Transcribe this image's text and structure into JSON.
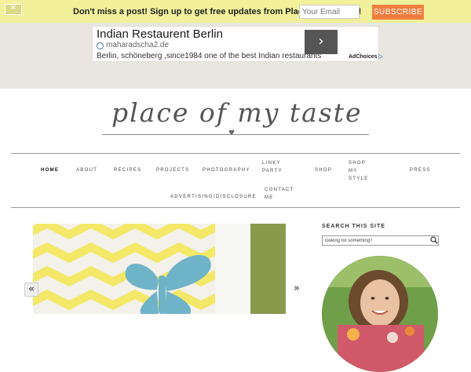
{
  "notify_bar": {
    "close_label": "✕",
    "message": "Don't miss a post! Sign up to get free updates from Place Of My Taste!",
    "email_placeholder": "Your Email",
    "subscribe_label": "SUBSCRIBE"
  },
  "ad": {
    "title": "Indian Restaurent Berlin",
    "url": "maharadscha2.de",
    "description": "Berlin, schöneberg ,since1984 one of the best Indian restaurants",
    "arrow": "›",
    "adchoices": "AdChoices"
  },
  "logo": {
    "text": "place of my taste",
    "heart": "♥"
  },
  "nav": {
    "items": [
      {
        "label": "HOME"
      },
      {
        "label": "ABOUT"
      },
      {
        "label": "RECIPES"
      },
      {
        "label": "PROJECTS"
      },
      {
        "label": "PHOTOGRAPHY"
      },
      {
        "label": "LINKY PARTY"
      },
      {
        "label": "SHOP"
      },
      {
        "label": "SHOP MY STYLE"
      },
      {
        "label": "PRESS"
      },
      {
        "label": "ADVERTISING/DISCLOSURE"
      },
      {
        "label": "CONTACT ME"
      }
    ]
  },
  "slider": {
    "prev": "«",
    "next": "»"
  },
  "sidebar": {
    "search_title": "SEARCH THIS SITE",
    "search_placeholder": "looking for something?"
  },
  "colors": {
    "notify_bg": "#f2f09a",
    "subscribe_btn": "#f07e3f",
    "ad_area_bg": "#e8e6de",
    "chevron_yellow": "#f4e869",
    "butterfly_blue": "#6fb3c8"
  }
}
